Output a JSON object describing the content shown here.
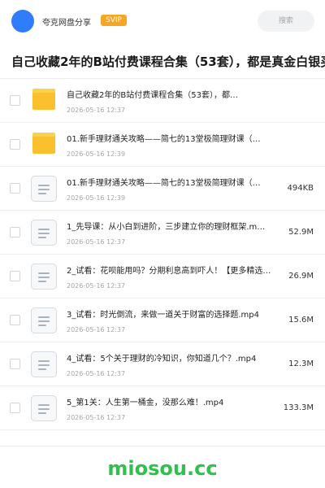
{
  "header": {
    "username": "夸克网盘分享",
    "vip_badge": "SVIP",
    "search_placeholder": "搜索"
  },
  "folder": {
    "title": "自己收藏2年的B站付费课程合集（53套），都是真金白银买"
  },
  "files": [
    {
      "type": "folder",
      "name": "自己收藏2年的B站付费课程合集（53套），都…",
      "date": "2026-05-16 12:37",
      "size": ""
    },
    {
      "type": "folder",
      "name": "01.新手理财通关攻略——简七的13堂极简理财课（…",
      "date": "2026-05-16 12:39",
      "size": ""
    },
    {
      "type": "file",
      "name": "01.新手理财通关攻略——简七的13堂极简理财课（…",
      "date": "2026-05-16 12:39",
      "size": "494KB"
    },
    {
      "type": "file",
      "name": "1_先导课：从小白到进阶，三步建立你的理财框架.m…",
      "date": "2026-05-16 12:37",
      "size": "52.9M"
    },
    {
      "type": "file",
      "name": "2_试看：花呗能用吗？分期利息高到吓人！【更多精选…",
      "date": "2026-05-16 12:37",
      "size": "26.9M"
    },
    {
      "type": "file",
      "name": "3_试看：时光倒流，来做一道关于财富的选择题.mp4",
      "date": "2026-05-16 12:37",
      "size": "15.6M"
    },
    {
      "type": "file",
      "name": "4_试看：5个关于理财的冷知识，你知道几个？.mp4",
      "date": "2026-05-16 12:37",
      "size": "12.3M"
    },
    {
      "type": "file",
      "name": "5_第1关：人生第一桶金，没那么难！.mp4",
      "date": "2026-05-16 12:37",
      "size": "133.3M"
    }
  ],
  "watermark": "miosou.cc",
  "colors": {
    "avatar": "#2f7dfb",
    "vip": "#f5a623",
    "folder_icon": "#fbc02d",
    "watermark": "#2ec14b"
  }
}
